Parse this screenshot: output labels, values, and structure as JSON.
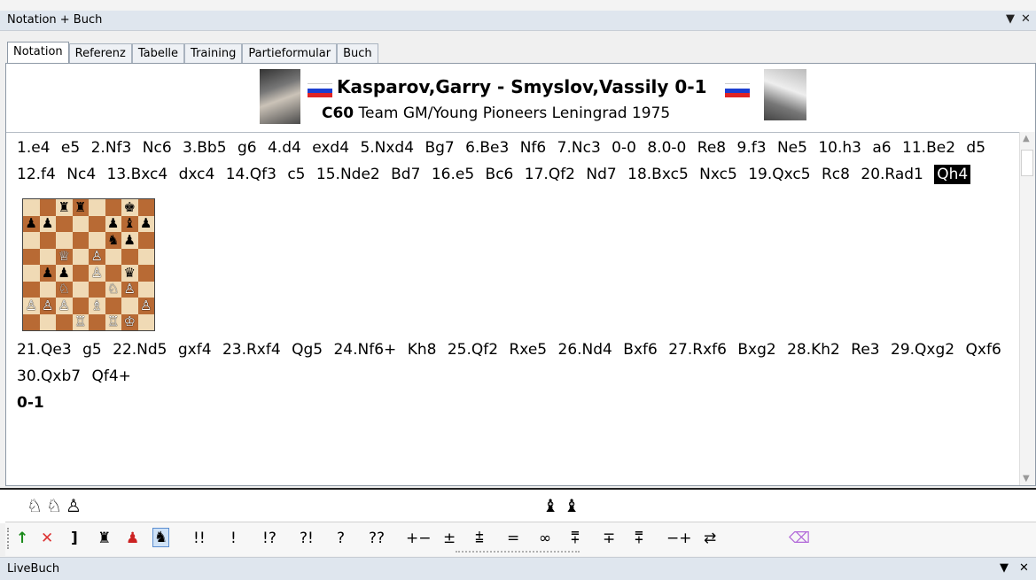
{
  "window": {
    "title": "Notation + Buch",
    "pin_icon": "▼",
    "close_icon": "✕"
  },
  "tabs": [
    "Notation",
    "Referenz",
    "Tabelle",
    "Training",
    "Partieformular",
    "Buch"
  ],
  "header": {
    "players": "Kasparov,Garry - Smyslov,Vassily 0-1",
    "eco": "C60",
    "event": "Team GM/Young Pioneers Leningrad 1975",
    "flag_colors": [
      "#ffffff",
      "#1c3fd1",
      "#e02424"
    ]
  },
  "moves_part1": [
    "1.e4",
    "e5",
    "2.Nf3",
    "Nc6",
    "3.Bb5",
    "g6",
    "4.d4",
    "exd4",
    "5.Nxd4",
    "Bg7",
    "6.Be3",
    "Nf6",
    "7.Nc3",
    "0-0",
    "8.0-0",
    "Re8",
    "9.f3",
    "Ne5",
    "10.h3",
    "a6",
    "11.Be2",
    "d5",
    "12.f4",
    "Nc4",
    "13.Bxc4",
    "dxc4",
    "14.Qf3",
    "c5",
    "15.Nde2",
    "Bd7",
    "16.e5",
    "Bc6",
    "17.Qf2",
    "Nd7",
    "18.Bxc5",
    "Nxc5",
    "19.Qxc5",
    "Rc8",
    "20.Rad1"
  ],
  "current_move": "Qh4",
  "moves_part2": [
    "21.Qe3",
    "g5",
    "22.Nd5",
    "gxf4",
    "23.Rxf4",
    "Qg5",
    "24.Nf6+",
    "Kh8",
    "25.Qf2",
    "Rxe5",
    "26.Nd4",
    "Bxf6",
    "27.Rxf6",
    "Bxg2",
    "28.Kh2",
    "Re3",
    "29.Qxg2",
    "Qxf6",
    "30.Qxb7",
    "Qf4+"
  ],
  "result": "0-1",
  "board": [
    "..rr..k.",
    "pp...pbp",
    ".....np.",
    "..Q.P...",
    ".pp.P.q.",
    "..N..NP.",
    "PPP.B..P",
    "...R.RK."
  ],
  "piece_bar": {
    "left": [
      "♘",
      "♘",
      "♙"
    ],
    "right": [
      "♝",
      "♝"
    ]
  },
  "toolbar": {
    "arrow_up": "↑",
    "delete": "✕",
    "bracket": "]",
    "rook_icon": "♜",
    "pawn_icon": "♟",
    "board_icon": "♞",
    "symbols": [
      "!!",
      "!",
      "!?",
      "?!",
      "?",
      "??",
      "+−",
      "±",
      "⩲",
      "=",
      "∞",
      "⩱",
      "∓",
      "⩱",
      "−+",
      "⇄"
    ],
    "eraser_icon": "⌫"
  },
  "livebar": {
    "title": "LiveBuch",
    "pin_icon": "▼",
    "close_icon": "✕"
  }
}
